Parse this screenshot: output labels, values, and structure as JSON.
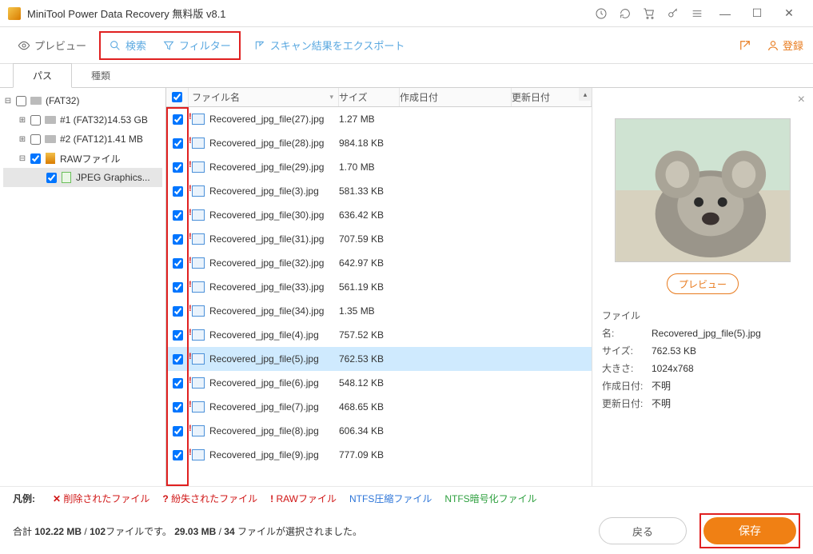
{
  "app": {
    "title": "MiniTool Power Data Recovery 無料版 v8.1"
  },
  "toolbar": {
    "preview": "プレビュー",
    "search": "検索",
    "filter": "フィルター",
    "export": "スキャン結果をエクスポート",
    "register": "登録"
  },
  "tabs": {
    "path": "パス",
    "type": "種類"
  },
  "tree": {
    "root": "(FAT32)",
    "p1": "#1 (FAT32)14.53 GB",
    "p2": "#2 (FAT12)1.41 MB",
    "raw": "RAWファイル",
    "jpeg": "JPEG Graphics..."
  },
  "columns": {
    "name": "ファイル名",
    "size": "サイズ",
    "created": "作成日付",
    "updated": "更新日付"
  },
  "files": [
    {
      "name": "Recovered_jpg_file(27).jpg",
      "size": "1.27 MB"
    },
    {
      "name": "Recovered_jpg_file(28).jpg",
      "size": "984.18 KB"
    },
    {
      "name": "Recovered_jpg_file(29).jpg",
      "size": "1.70 MB"
    },
    {
      "name": "Recovered_jpg_file(3).jpg",
      "size": "581.33 KB"
    },
    {
      "name": "Recovered_jpg_file(30).jpg",
      "size": "636.42 KB"
    },
    {
      "name": "Recovered_jpg_file(31).jpg",
      "size": "707.59 KB"
    },
    {
      "name": "Recovered_jpg_file(32).jpg",
      "size": "642.97 KB"
    },
    {
      "name": "Recovered_jpg_file(33).jpg",
      "size": "561.19 KB"
    },
    {
      "name": "Recovered_jpg_file(34).jpg",
      "size": "1.35 MB"
    },
    {
      "name": "Recovered_jpg_file(4).jpg",
      "size": "757.52 KB"
    },
    {
      "name": "Recovered_jpg_file(5).jpg",
      "size": "762.53 KB",
      "selected": true
    },
    {
      "name": "Recovered_jpg_file(6).jpg",
      "size": "548.12 KB"
    },
    {
      "name": "Recovered_jpg_file(7).jpg",
      "size": "468.65 KB"
    },
    {
      "name": "Recovered_jpg_file(8).jpg",
      "size": "606.34 KB"
    },
    {
      "name": "Recovered_jpg_file(9).jpg",
      "size": "777.09 KB"
    }
  ],
  "preview": {
    "button": "プレビュー",
    "labels": {
      "name": "ファイル名:",
      "size": "サイズ:",
      "dim": "大きさ:",
      "created": "作成日付:",
      "updated": "更新日付:"
    },
    "values": {
      "name": "Recovered_jpg_file(5).jpg",
      "size": "762.53 KB",
      "dim": "1024x768",
      "created": "不明",
      "updated": "不明"
    }
  },
  "legend": {
    "title": "凡例:",
    "deleted": "削除されたファイル",
    "lost": "紛失されたファイル",
    "raw": "RAWファイル",
    "ntfs_comp": "NTFS圧縮ファイル",
    "ntfs_enc": "NTFS暗号化ファイル"
  },
  "summary": {
    "t1": "合計 ",
    "total_size": "102.22 MB",
    "sep1": " / ",
    "total_files": "102",
    "t2": "ファイルです。 ",
    "sel_size": "29.03 MB",
    "sep2": " / ",
    "sel_files": "34",
    "t3": " ファイルが選択されました。"
  },
  "buttons": {
    "back": "戻る",
    "save": "保存"
  }
}
